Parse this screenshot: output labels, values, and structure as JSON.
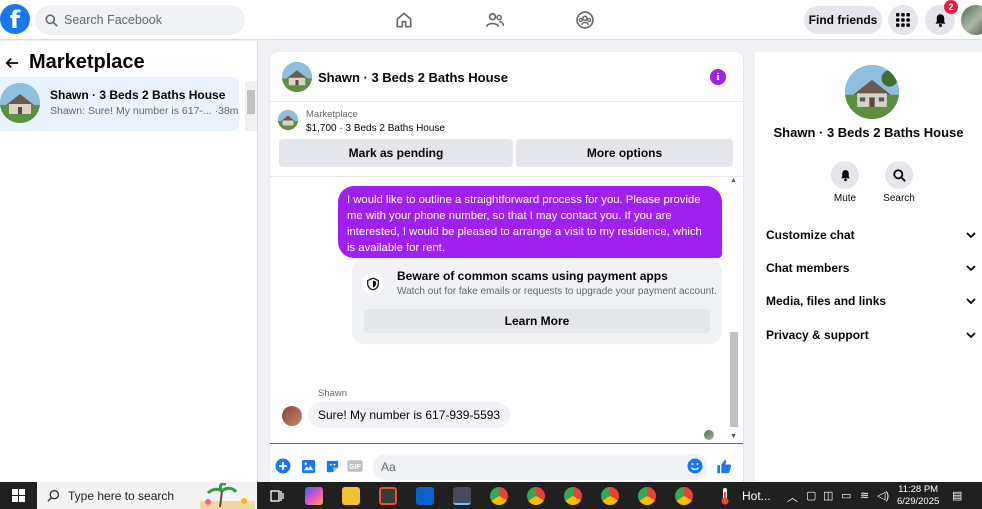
{
  "topbar": {
    "search_placeholder": "Search Facebook",
    "find_friends_label": "Find friends",
    "notifications_count": "2"
  },
  "left_panel": {
    "title": "Marketplace",
    "conversation": {
      "name": "Shawn · 3 Beds 2 Baths House",
      "preview": "Shawn: Sure! My number is 617-... ·38m"
    }
  },
  "chat": {
    "header_name": "Shawn · 3 Beds 2 Baths House",
    "marketplace_label": "Marketplace",
    "listing_price": "$1,700 · 3 Beds 2 Baths House",
    "mark_pending_label": "Mark as pending",
    "more_options_label": "More options",
    "outgoing_message": "I would like to outline a straightforward process for you. Please provide me with your phone number, so that I may contact you. If you are interested, I would be pleased to arrange a visit to my residence, which is available for rent.",
    "scam_title": "Beware of common scams using payment apps",
    "scam_subtitle": "Watch out for fake emails or requests to upgrade your payment account.",
    "learn_more_label": "Learn More",
    "incoming_sender": "Shawn",
    "incoming_message": "Sure!  My number is 617-939-5593",
    "composer_placeholder": "Aa"
  },
  "right_panel": {
    "name": "Shawn · 3 Beds 2 Baths House",
    "mute_label": "Mute",
    "search_label": "Search",
    "rows": [
      "Customize chat",
      "Chat members",
      "Media, files and links",
      "Privacy & support"
    ]
  },
  "taskbar": {
    "search_placeholder": "Type here to search",
    "hot_label": "Hot...",
    "time": "11:28 PM",
    "date": "6/29/2025"
  },
  "colors": {
    "fb_blue": "#1877f2",
    "purple_accent": "#a020f0",
    "badge_red": "#e41e3f"
  }
}
